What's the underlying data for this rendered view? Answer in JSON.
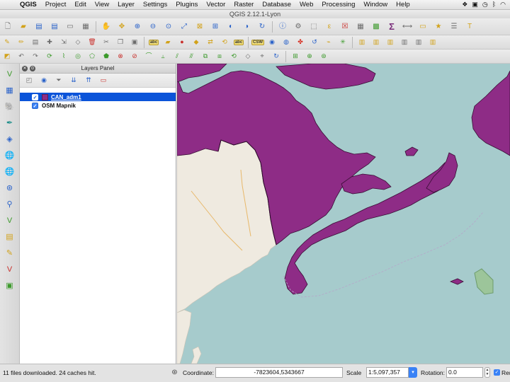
{
  "menubar": {
    "app_name": "QGIS",
    "items": [
      "Project",
      "Edit",
      "View",
      "Layer",
      "Settings",
      "Plugins",
      "Vector",
      "Raster",
      "Database",
      "Web",
      "Processing",
      "Window",
      "Help"
    ]
  },
  "window": {
    "title": "QGIS 2.12.1-Lyon"
  },
  "layers_panel": {
    "title": "Layers Panel",
    "layers": [
      {
        "name": "CAN_adm1",
        "checked": true,
        "selected": true,
        "swatch_color": "#8e2c86"
      },
      {
        "name": "OSM Mapnik",
        "checked": true,
        "selected": false
      }
    ]
  },
  "map": {
    "water_color": "#a6cbcc",
    "land_color": "#efeae0",
    "layer_fill_color": "#8e2c86"
  },
  "statusbar": {
    "message": "11 files downloaded. 24 caches hit.",
    "coordinate_label": "Coordinate:",
    "coordinate_value": "-7823604,5343667",
    "scale_label": "Scale",
    "scale_value": "1:5,097,357",
    "rotation_label": "Rotation:",
    "rotation_value": "0.0",
    "render_label": "Render"
  }
}
